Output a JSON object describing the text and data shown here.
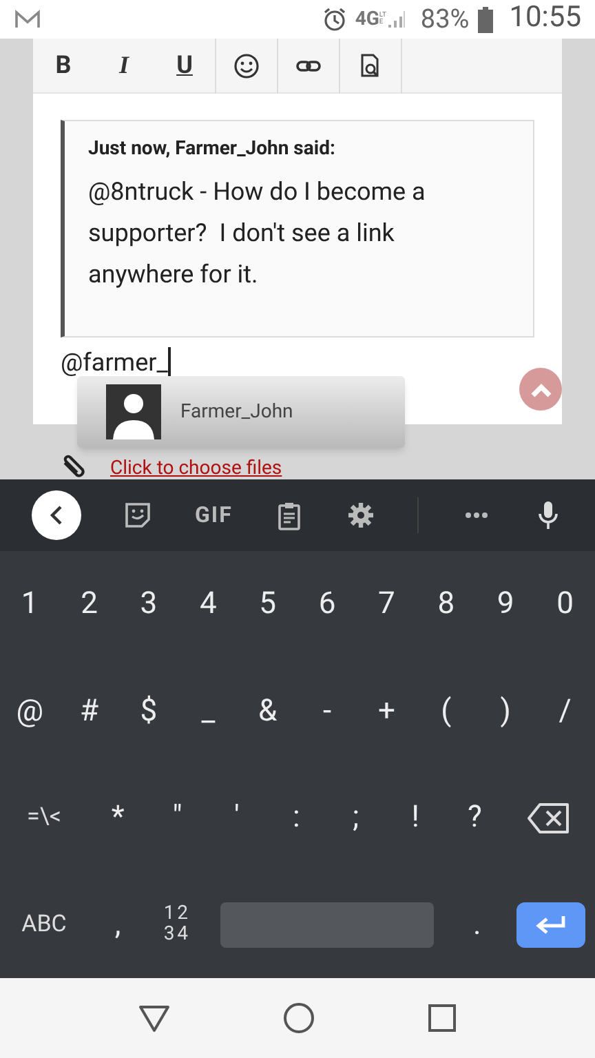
{
  "status_bar": {
    "network": "4G",
    "network_sub": "LTE",
    "battery": "83%",
    "time": "10:55"
  },
  "toolbar": {
    "format_buttons": [
      {
        "label": "B",
        "kind": "bold"
      },
      {
        "label": "I",
        "kind": "italic"
      },
      {
        "label": "U",
        "kind": "underline"
      }
    ]
  },
  "quote": {
    "header": "Just now, Farmer_John said:",
    "body": "@8ntruck - How do I become a supporter?  I don't see a link anywhere for it."
  },
  "editor": {
    "value": "@farmer_"
  },
  "mention_popup": {
    "items": [
      {
        "name": "Farmer_John"
      }
    ]
  },
  "attachment": {
    "link": "Click to choose files"
  },
  "keyboard": {
    "toolbar": {
      "gif": "GIF"
    },
    "rows": [
      [
        {
          "kind": "text",
          "label": "1"
        },
        {
          "kind": "text",
          "label": "2"
        },
        {
          "kind": "text",
          "label": "3"
        },
        {
          "kind": "text",
          "label": "4"
        },
        {
          "kind": "text",
          "label": "5"
        },
        {
          "kind": "text",
          "label": "6"
        },
        {
          "kind": "text",
          "label": "7"
        },
        {
          "kind": "text",
          "label": "8"
        },
        {
          "kind": "text",
          "label": "9"
        },
        {
          "kind": "text",
          "label": "0"
        }
      ],
      [
        {
          "kind": "text",
          "label": "@"
        },
        {
          "kind": "text",
          "label": "#"
        },
        {
          "kind": "text",
          "label": "$"
        },
        {
          "kind": "text",
          "label": "_"
        },
        {
          "kind": "text",
          "label": "&"
        },
        {
          "kind": "text",
          "label": "-"
        },
        {
          "kind": "text",
          "label": "+"
        },
        {
          "kind": "text",
          "label": "("
        },
        {
          "kind": "text",
          "label": ")"
        },
        {
          "kind": "text",
          "label": "/"
        }
      ],
      [
        {
          "kind": "wide",
          "label": "=\\<"
        },
        {
          "kind": "text",
          "label": "*"
        },
        {
          "kind": "text",
          "label": "\""
        },
        {
          "kind": "text",
          "label": "'"
        },
        {
          "kind": "text",
          "label": ":"
        },
        {
          "kind": "text",
          "label": ";"
        },
        {
          "kind": "text",
          "label": "!"
        },
        {
          "kind": "text",
          "label": "?"
        },
        {
          "kind": "backspace"
        }
      ],
      [
        {
          "kind": "wide",
          "label": "ABC"
        },
        {
          "kind": "text",
          "label": ","
        },
        {
          "kind": "stacked",
          "lines": [
            "12",
            "34"
          ]
        },
        {
          "kind": "space"
        },
        {
          "kind": "text",
          "label": "."
        },
        {
          "kind": "enter"
        }
      ]
    ]
  }
}
